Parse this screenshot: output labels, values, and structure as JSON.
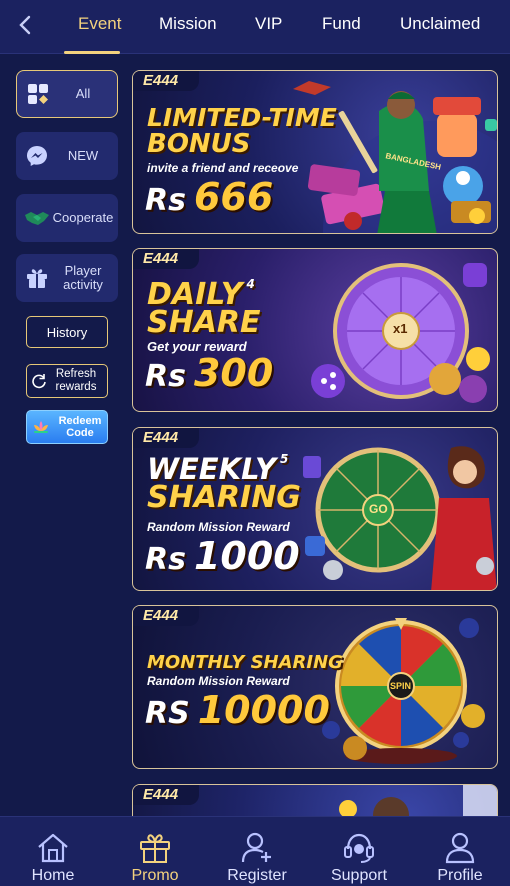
{
  "topnav": {
    "tabs": [
      {
        "label": "Event",
        "active": true
      },
      {
        "label": "Mission"
      },
      {
        "label": "VIP"
      },
      {
        "label": "Fund"
      },
      {
        "label": "Unclaimed"
      }
    ]
  },
  "sidebar": {
    "items": [
      {
        "label": "All",
        "icon": "grid-icon",
        "active": true
      },
      {
        "label": "NEW",
        "icon": "messenger-icon"
      },
      {
        "label": "Cooperate",
        "icon": "handshake-icon"
      },
      {
        "label": "Player activity",
        "icon": "gift-icon"
      }
    ],
    "history_label": "History",
    "refresh_label": "Refresh rewards",
    "redeem_label": "Redeem Code"
  },
  "banners": [
    {
      "brand": "E444",
      "title1": "LIMITED-TIME",
      "title2": "BONUS",
      "subtitle": "invite a friend and receove",
      "currency": "Rs",
      "amount": "666",
      "shirt_text": "BANGLADESH"
    },
    {
      "brand": "E444",
      "title1": "DAILY",
      "title2": "SHARE",
      "badge": "4",
      "subtitle": "Get your reward",
      "currency": "Rs",
      "amount": "300",
      "wheel_center": "x1"
    },
    {
      "brand": "E444",
      "title1": "WEEKLY",
      "title2": "SHARING",
      "badge": "5",
      "subtitle": "Random Mission Reward",
      "currency": "Rs",
      "amount": "1000",
      "wheel_center": "GO"
    },
    {
      "brand": "E444",
      "title1": "MONTHLY SHARING",
      "subtitle": "Random Mission Reward",
      "currency": "RS",
      "amount": "10000",
      "wheel_center": "SPIN"
    },
    {
      "brand": "E444"
    }
  ],
  "bottomnav": {
    "items": [
      {
        "label": "Home",
        "icon": "home-icon"
      },
      {
        "label": "Promo",
        "icon": "gift-icon",
        "active": true
      },
      {
        "label": "Register",
        "icon": "add-user-icon"
      },
      {
        "label": "Support",
        "icon": "headset-icon"
      },
      {
        "label": "Profile",
        "icon": "user-icon"
      }
    ]
  },
  "colors": {
    "accent": "#f3d27e",
    "background": "#131a4a",
    "nav": "#1b2260"
  }
}
